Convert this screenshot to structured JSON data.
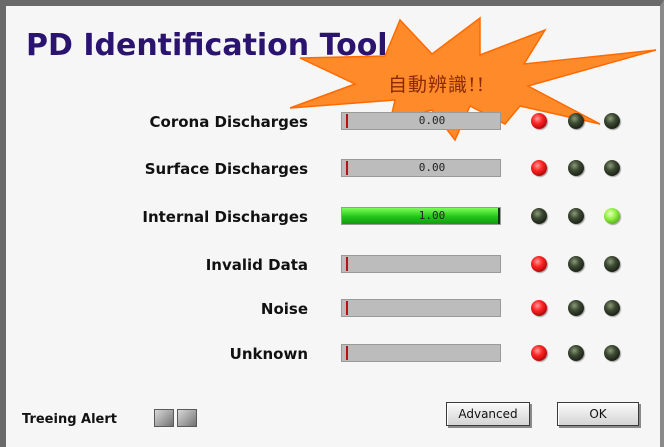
{
  "window": {
    "title": "PD Identification Tool"
  },
  "callout": {
    "text": "自動辨識!!",
    "fill_color": "#ff8a2a",
    "outline_color": "#ff6a00"
  },
  "rows": [
    {
      "label": "Corona Discharges",
      "value_text": "0.00",
      "fill_fraction": 0,
      "leds": [
        "red",
        "dark",
        "dark"
      ]
    },
    {
      "label": "Surface Discharges",
      "value_text": "0.00",
      "fill_fraction": 0,
      "leds": [
        "red",
        "dark",
        "dark"
      ]
    },
    {
      "label": "Internal Discharges",
      "value_text": "1.00",
      "fill_fraction": 1,
      "leds": [
        "dark",
        "dark",
        "green"
      ]
    },
    {
      "label": "Invalid Data",
      "value_text": "",
      "fill_fraction": 0,
      "leds": [
        "red",
        "dark",
        "dark"
      ]
    },
    {
      "label": "Noise",
      "value_text": "",
      "fill_fraction": 0,
      "leds": [
        "red",
        "dark",
        "dark"
      ]
    },
    {
      "label": "Unknown",
      "value_text": "",
      "fill_fraction": 0,
      "leds": [
        "red",
        "dark",
        "dark"
      ]
    }
  ],
  "footer": {
    "treeing_label": "Treeing Alert",
    "advanced_label": "Advanced",
    "ok_label": "OK"
  },
  "colors": {
    "title": "#2a1470",
    "meter_fill": "#22c41a",
    "led_red": "#ff2626",
    "led_green": "#8ef03c",
    "led_dark": "#1e2618"
  }
}
